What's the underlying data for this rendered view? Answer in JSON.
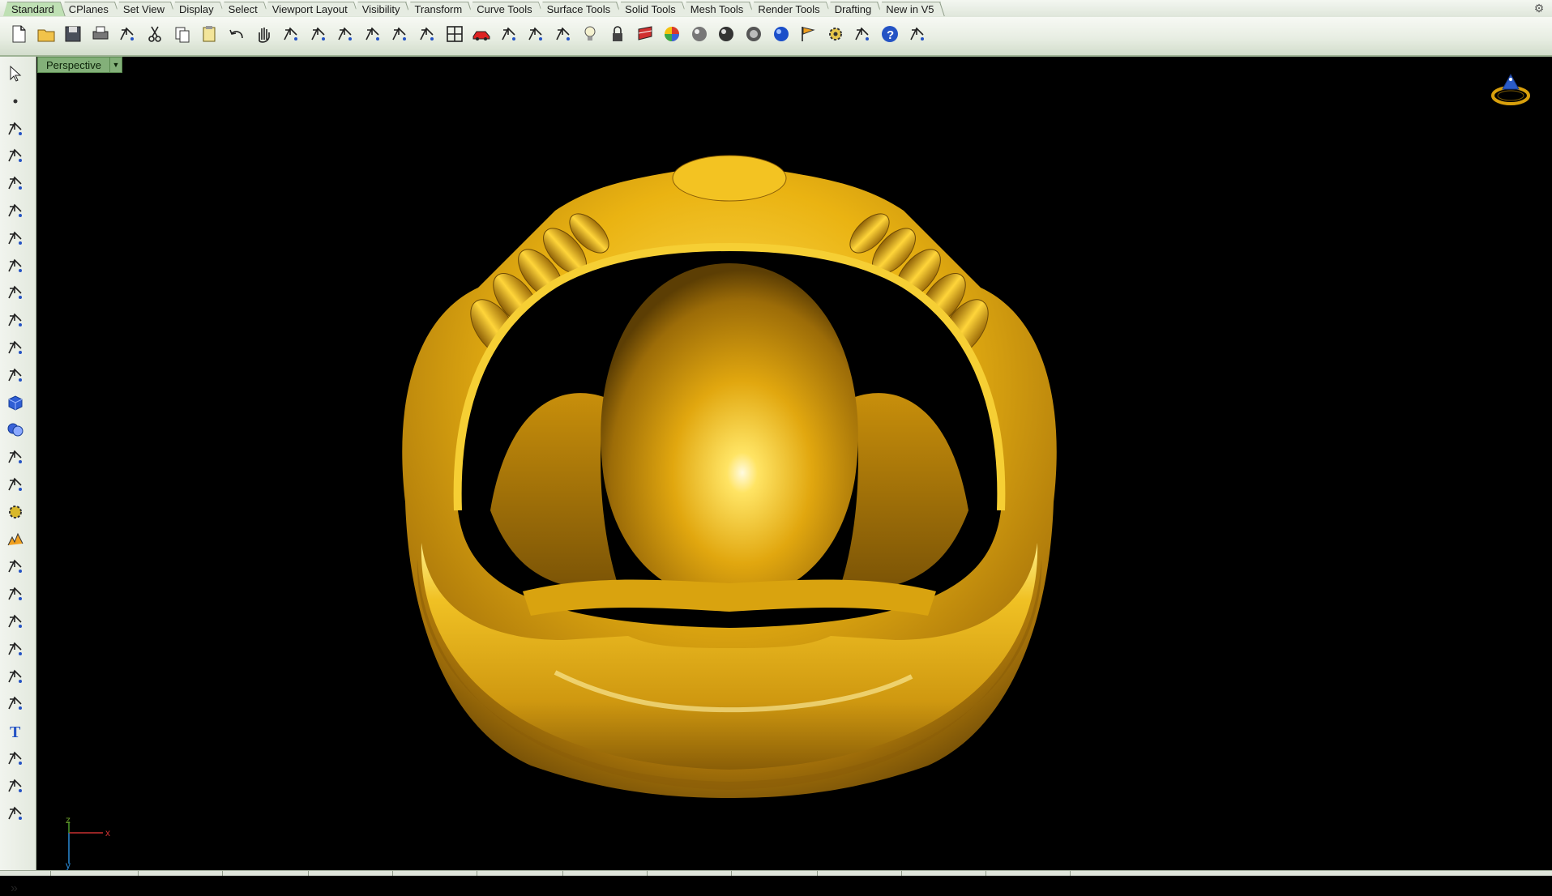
{
  "tabs": [
    "Standard",
    "CPlanes",
    "Set View",
    "Display",
    "Select",
    "Viewport Layout",
    "Visibility",
    "Transform",
    "Curve Tools",
    "Surface Tools",
    "Solid Tools",
    "Mesh Tools",
    "Render Tools",
    "Drafting",
    "New in V5"
  ],
  "active_tab": "Standard",
  "toolbar_icons": [
    "new-file-icon",
    "open-folder-icon",
    "save-icon",
    "print-icon",
    "import-icon",
    "cut-icon",
    "copy-icon",
    "paste-icon",
    "undo-icon",
    "pan-hand-icon",
    "rotate-view-icon",
    "zoom-dynamic-icon",
    "zoom-window-icon",
    "zoom-extents-icon",
    "zoom-selected-icon",
    "undo-view-icon",
    "four-viewports-icon",
    "car-icon",
    "tools-icon",
    "circle-select-icon",
    "grid-snap-icon",
    "light-bulb-icon",
    "lock-icon",
    "layer-icon",
    "color-wheel-icon",
    "shaded-sphere-icon",
    "rendered-sphere-icon",
    "ghosted-sphere-icon",
    "blue-sphere-icon",
    "edit-flag-icon",
    "gear-options-icon",
    "dimension-icon",
    "help-icon",
    "cap-tool-icon"
  ],
  "side_icons": [
    "select-arrow-icon",
    "point-icon",
    "polyline-icon",
    "curve-icon",
    "circle-icon",
    "ellipse-icon",
    "arc-icon",
    "rectangle-icon",
    "polygon-icon",
    "fillet-curve-icon",
    "surface-edit-icon",
    "patch-icon",
    "solid-box-icon",
    "boolean-icon",
    "extrude-icon",
    "surface-plane-icon",
    "gear-solid-icon",
    "explode-icon",
    "trim-icon",
    "split-icon",
    "join-icon",
    "group-icon",
    "fillet-icon",
    "blend-icon",
    "text-icon",
    "transform-icon",
    "array-icon",
    "dimension-edit-icon"
  ],
  "viewport": {
    "name": "Perspective",
    "axis_labels": {
      "x": "x",
      "y": "y",
      "z": "z"
    }
  },
  "more_button": "»",
  "colors": {
    "gold": "#e8b20c",
    "viewport_bg": "#000000",
    "active_tab": "#bfe0b4",
    "viewport_label": "#83b079"
  }
}
